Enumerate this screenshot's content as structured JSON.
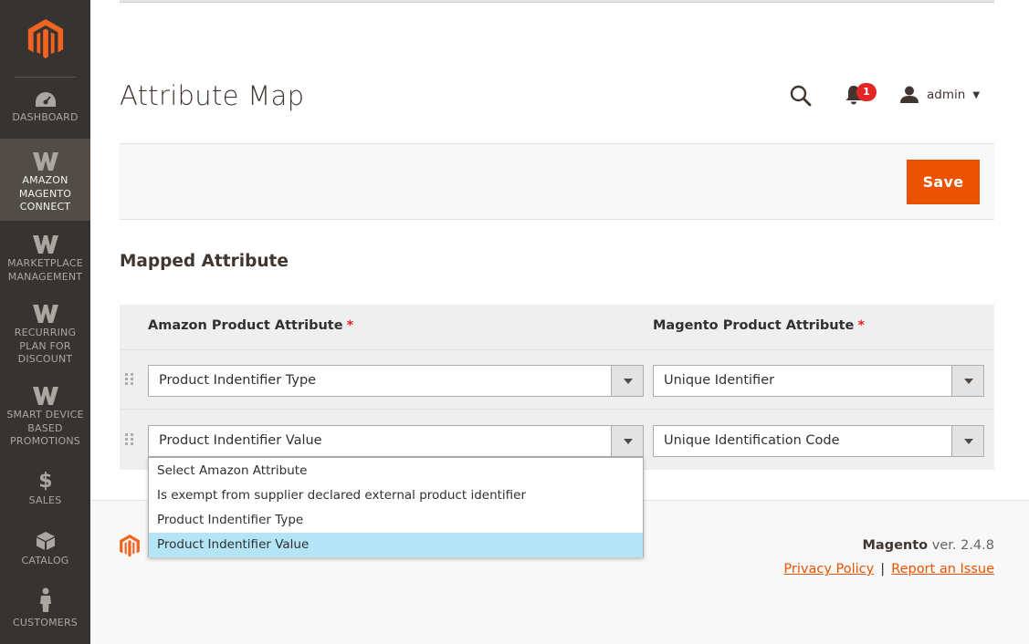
{
  "sidebar": {
    "items": [
      {
        "label": "DASHBOARD",
        "icon": "dashboard-gauge-icon"
      },
      {
        "label": "AMAZON MAGENTO CONNECT",
        "icon": "w-logo-icon",
        "active": true
      },
      {
        "label": "MARKETPLACE MANAGEMENT",
        "icon": "w-logo-icon"
      },
      {
        "label": "RECURRING PLAN FOR DISCOUNT",
        "icon": "w-logo-icon"
      },
      {
        "label": "SMART DEVICE BASED PROMOTIONS",
        "icon": "w-logo-icon"
      },
      {
        "label": "SALES",
        "icon": "dollar-icon"
      },
      {
        "label": "CATALOG",
        "icon": "cube-icon"
      },
      {
        "label": "CUSTOMERS",
        "icon": "person-icon"
      }
    ]
  },
  "header": {
    "title": "Attribute Map",
    "notifications_count": "1",
    "user": "admin"
  },
  "actions": {
    "save_label": "Save"
  },
  "section": {
    "title": "Mapped Attribute"
  },
  "grid": {
    "columns": {
      "amazon": "Amazon Product Attribute",
      "magento": "Magento Product Attribute",
      "required_mark": "*"
    },
    "rows": [
      {
        "amazon": "Product Indentifier Type",
        "magento": "Unique Identifier"
      },
      {
        "amazon": "Product Indentifier Value",
        "magento": "Unique Identification Code"
      }
    ]
  },
  "dropdown": {
    "options": [
      "Select Amazon Attribute",
      "Is exempt from supplier declared external product identifier",
      "Product Indentifier Type",
      "Product Indentifier Value"
    ],
    "selected_index": 3
  },
  "footer": {
    "brand": "Magento",
    "version": "ver. 2.4.8",
    "privacy": "Privacy Policy",
    "separator": "|",
    "report": "Report an Issue"
  },
  "colors": {
    "sidebar_bg": "#373330",
    "accent": "#eb5202",
    "selected_option": "#b3e5f7",
    "badge": "#e22626"
  }
}
